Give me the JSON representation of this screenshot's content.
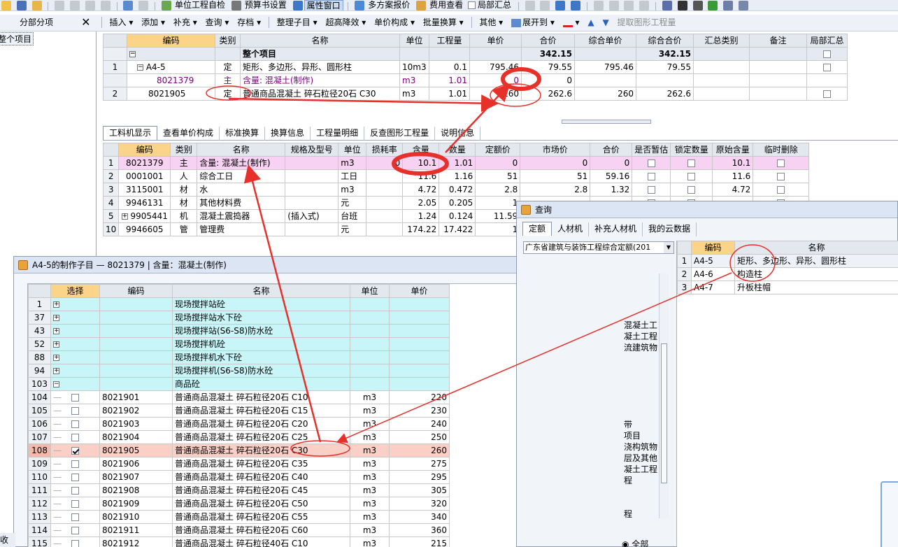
{
  "toolbar1": {
    "items": [
      "单位工程自检",
      "预算书设置",
      "属性窗口",
      "多方案报价",
      "费用查看",
      "局部汇总"
    ]
  },
  "toolbar2": {
    "panel_title": "分部分项",
    "items": [
      "插入",
      "添加",
      "补充",
      "查询",
      "存档",
      "整理子目",
      "超高降效",
      "单价构成",
      "批量换算",
      "其他",
      "展开到",
      "提取图形工程量"
    ]
  },
  "left_tree": {
    "root": "整个项目"
  },
  "main_grid": {
    "headers": [
      "编码",
      "类别",
      "名称",
      "单位",
      "工程量",
      "单价",
      "合价",
      "综合单价",
      "综合合价",
      "汇总类别",
      "备注",
      "局部汇总"
    ],
    "rows": [
      {
        "no": "",
        "code": "",
        "type": "",
        "name": "整个项目",
        "unit": "",
        "qty": "",
        "price": "",
        "total": "342.15",
        "cprice": "",
        "ctotal": "342.15"
      },
      {
        "no": "1",
        "code": "A4-5",
        "type": "定",
        "name": "矩形、多边形、异形、圆形柱",
        "unit": "10m3",
        "qty": "0.1",
        "price": "795.46",
        "total": "79.55",
        "cprice": "795.46",
        "ctotal": "79.55"
      },
      {
        "no": "",
        "code": "8021379",
        "type": "主",
        "name": "含量: 混凝土(制作)",
        "unit": "m3",
        "qty": "1.01",
        "price": "0",
        "total": "0",
        "cprice": "",
        "ctotal": ""
      },
      {
        "no": "2",
        "code": "8021905",
        "type": "定",
        "name": "普通商品混凝土 碎石粒径20石 C30",
        "unit": "m3",
        "qty": "1.01",
        "price": "260",
        "total": "262.6",
        "cprice": "260",
        "ctotal": "262.6"
      }
    ]
  },
  "lower_tabs": [
    "工料机显示",
    "查看单价构成",
    "标准换算",
    "换算信息",
    "工程量明细",
    "反查图形工程量",
    "说明信息"
  ],
  "res_grid": {
    "headers": [
      "编码",
      "类别",
      "名称",
      "规格及型号",
      "单位",
      "损耗率",
      "含量",
      "数量",
      "定额价",
      "市场价",
      "合价",
      "是否暂估",
      "锁定数量",
      "原始含量",
      "临时删除"
    ],
    "rows": [
      {
        "no": "1",
        "code": "8021379",
        "type": "主",
        "name": "含量: 混凝土(制作)",
        "spec": "",
        "unit": "m3",
        "loss": "0",
        "amt": "10.1",
        "qty": "1.01",
        "dprice": "0",
        "mprice": "0",
        "total": "0",
        "orig": "10.1"
      },
      {
        "no": "2",
        "code": "0001001",
        "type": "人",
        "name": "综合工日",
        "spec": "",
        "unit": "工日",
        "loss": "",
        "amt": "11.6",
        "qty": "1.16",
        "dprice": "51",
        "mprice": "51",
        "total": "59.16",
        "orig": "11.6"
      },
      {
        "no": "3",
        "code": "3115001",
        "type": "材",
        "name": "水",
        "spec": "",
        "unit": "m3",
        "loss": "",
        "amt": "4.72",
        "qty": "0.472",
        "dprice": "2.8",
        "mprice": "2.8",
        "total": "1.32",
        "orig": "4.72"
      },
      {
        "no": "4",
        "code": "9946131",
        "type": "材",
        "name": "其他材料费",
        "spec": "",
        "unit": "元",
        "loss": "",
        "amt": "2.05",
        "qty": "0.205",
        "dprice": "1",
        "mprice": "",
        "total": "",
        "orig": ""
      },
      {
        "no": "5",
        "code": "9905441",
        "type": "机",
        "name": "混凝土震捣器",
        "spec": "(插入式)",
        "unit": "台班",
        "loss": "",
        "amt": "1.24",
        "qty": "0.124",
        "dprice": "11.59",
        "mprice": "",
        "total": "",
        "orig": ""
      },
      {
        "no": "10",
        "code": "9946605",
        "type": "管",
        "name": "管理费",
        "spec": "",
        "unit": "元",
        "loss": "",
        "amt": "174.22",
        "qty": "17.422",
        "dprice": "1",
        "mprice": "",
        "total": "",
        "orig": ""
      }
    ]
  },
  "query_win": {
    "title": "查询",
    "tabs": [
      "定额",
      "人材机",
      "补充人材机",
      "我的云数据"
    ],
    "select_value": "广东省建筑与装饰工程综合定额(201",
    "headers": [
      "编码",
      "名称"
    ],
    "rows": [
      {
        "no": "1",
        "code": "A4-5",
        "name": "矩形、多边形、异形、圆形柱"
      },
      {
        "no": "2",
        "code": "A4-6",
        "name": "构造柱"
      },
      {
        "no": "3",
        "code": "A4-7",
        "name": "升板柱帽"
      }
    ],
    "tree_fragments": [
      "混凝土工",
      "凝土工程",
      "流建筑物",
      "带",
      "项目",
      "浇构筑物",
      "层及其他",
      "凝土工程",
      "程",
      "程"
    ],
    "radio_label": "全部"
  },
  "sub_win": {
    "title": "A4-5的制作子目 — 8021379 | 含量：混凝土(制作)",
    "headers": [
      "选择",
      "编码",
      "名称",
      "单位",
      "单价"
    ],
    "groups": [
      {
        "no": "1",
        "name": "现场搅拌站砼"
      },
      {
        "no": "37",
        "name": "现场搅拌站水下砼"
      },
      {
        "no": "43",
        "name": "现场搅拌站(S6-S8)防水砼"
      },
      {
        "no": "52",
        "name": "现场搅拌机砼"
      },
      {
        "no": "88",
        "name": "现场搅拌机水下砼"
      },
      {
        "no": "94",
        "name": "现场搅拌机(S6-S8)防水砼"
      },
      {
        "no": "103",
        "name": "商品砼"
      }
    ],
    "rows": [
      {
        "no": "104",
        "code": "8021901",
        "name": "普通商品混凝土 碎石粒径20石 C10",
        "unit": "m3",
        "price": "220",
        "checked": false
      },
      {
        "no": "105",
        "code": "8021902",
        "name": "普通商品混凝土 碎石粒径20石 C15",
        "unit": "m3",
        "price": "230",
        "checked": false
      },
      {
        "no": "106",
        "code": "8021903",
        "name": "普通商品混凝土 碎石粒径20石 C20",
        "unit": "m3",
        "price": "240",
        "checked": false
      },
      {
        "no": "107",
        "code": "8021904",
        "name": "普通商品混凝土 碎石粒径20石 C25",
        "unit": "m3",
        "price": "250",
        "checked": false
      },
      {
        "no": "108",
        "code": "8021905",
        "name": "普通商品混凝土 碎石粒径20石 C30",
        "unit": "m3",
        "price": "260",
        "checked": true
      },
      {
        "no": "109",
        "code": "8021906",
        "name": "普通商品混凝土 碎石粒径20石 C35",
        "unit": "m3",
        "price": "275",
        "checked": false
      },
      {
        "no": "110",
        "code": "8021907",
        "name": "普通商品混凝土 碎石粒径20石 C40",
        "unit": "m3",
        "price": "295",
        "checked": false
      },
      {
        "no": "111",
        "code": "8021908",
        "name": "普通商品混凝土 碎石粒径20石 C45",
        "unit": "m3",
        "price": "305",
        "checked": false
      },
      {
        "no": "112",
        "code": "8021909",
        "name": "普通商品混凝土 碎石粒径20石 C50",
        "unit": "m3",
        "price": "320",
        "checked": false
      },
      {
        "no": "113",
        "code": "8021910",
        "name": "普通商品混凝土 碎石粒径20石 C55",
        "unit": "m3",
        "price": "340",
        "checked": false
      },
      {
        "no": "114",
        "code": "8021911",
        "name": "普通商品混凝土 碎石粒径20石 C60",
        "unit": "m3",
        "price": "360",
        "checked": false
      },
      {
        "no": "115",
        "code": "8021912",
        "name": "普通商品混凝土 碎石粒径40石 C10",
        "unit": "m3",
        "price": "215",
        "checked": false
      }
    ]
  },
  "status_fragment": "收缩",
  "colors": {
    "annotation": "#e8302a",
    "highlight_row": "#f9cfc6",
    "group_bg": "#c8f6f8",
    "header_hl": "#fbd48a",
    "pink_row": "#f7d2f2"
  }
}
